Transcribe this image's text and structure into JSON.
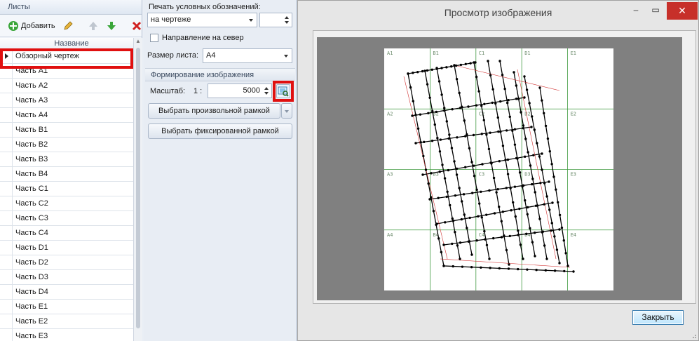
{
  "left_panel": {
    "caption": "Листы",
    "toolbar": {
      "add_label": "Добавить"
    },
    "column_header": "Название",
    "rows": [
      "Обзорный чертеж",
      "Часть A1",
      "Часть A2",
      "Часть A3",
      "Часть A4",
      "Часть B1",
      "Часть B2",
      "Часть B3",
      "Часть B4",
      "Часть C1",
      "Часть C2",
      "Часть C3",
      "Часть C4",
      "Часть D1",
      "Часть D2",
      "Часть D3",
      "Часть D4",
      "Часть E1",
      "Часть E2",
      "Часть E3"
    ],
    "selected_row": "Обзорный чертеж"
  },
  "middle_panel": {
    "legend_print_label": "Печать условных обозначений:",
    "legend_print_value": "на чертеже",
    "north_direction_label": "Направление на север",
    "sheet_size_label": "Размер листа:",
    "sheet_size_value": "A4",
    "group_caption": "Формирование изображения",
    "scale_label": "Масштаб:",
    "scale_prefix": "1 :",
    "scale_value": "5000",
    "select_free_frame": "Выбрать произвольной рамкой",
    "select_fixed_frame": "Выбрать фиксированной рамкой"
  },
  "preview_window": {
    "title": "Просмотр изображения",
    "close_button": "Закрыть",
    "grid_cells": [
      "A1",
      "B1",
      "C1",
      "D1",
      "E1",
      "A2",
      "B2",
      "C2",
      "D2",
      "E2",
      "A3",
      "B3",
      "C3",
      "D3",
      "E3",
      "A4",
      "B4",
      "C4",
      "D4",
      "E4"
    ]
  },
  "colors": {
    "highlight": "#e01010",
    "grid_line": "#3f9a3f",
    "drawing": "#000000",
    "accent_line": "#d03030"
  }
}
